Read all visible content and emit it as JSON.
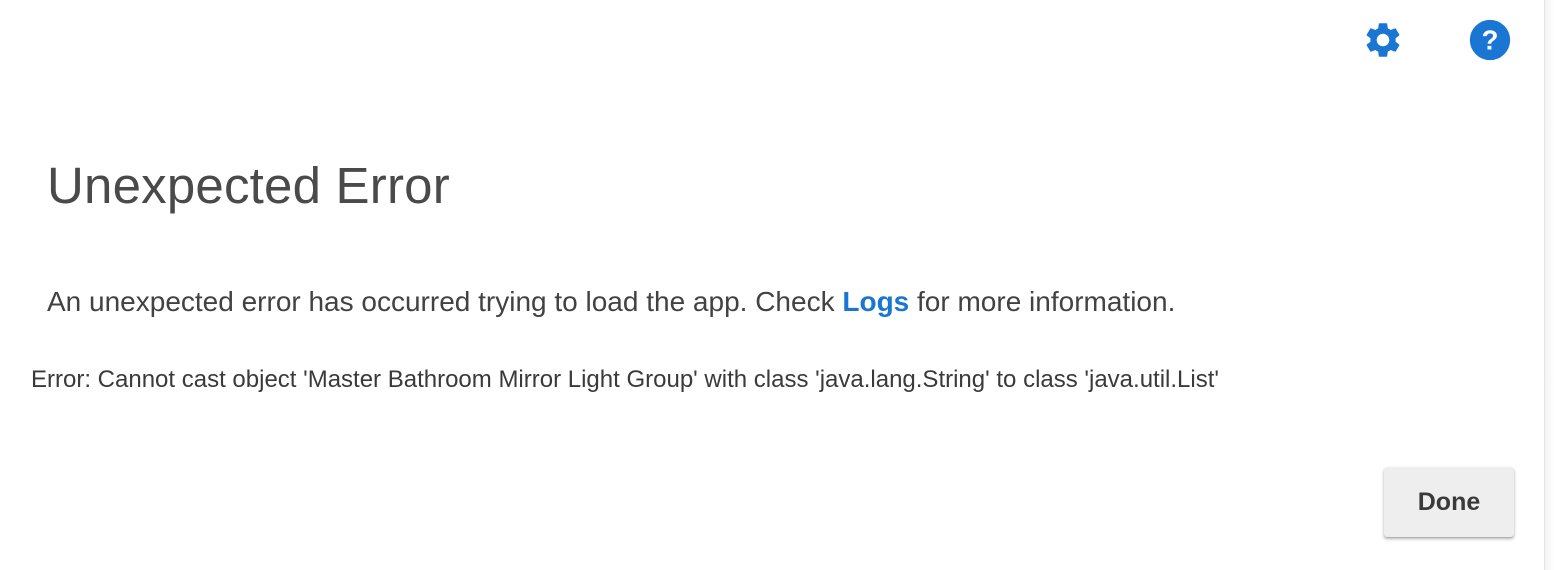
{
  "toolbar": {
    "settings_icon": "gear-icon",
    "help_icon": "help-circle-icon",
    "icon_color": "#1976d2"
  },
  "dialog": {
    "title": "Unexpected Error",
    "message_before_link": "An unexpected error has occurred trying to load the app. Check ",
    "logs_link_label": "Logs",
    "message_after_link": " for more information.",
    "error_detail": "Error: Cannot cast object 'Master Bathroom Mirror Light Group' with class 'java.lang.String' to class 'java.util.List'",
    "done_label": "Done"
  },
  "colors": {
    "link": "#1976d2",
    "title_text": "#4a4a4a",
    "button_bg": "#eeeeee"
  }
}
